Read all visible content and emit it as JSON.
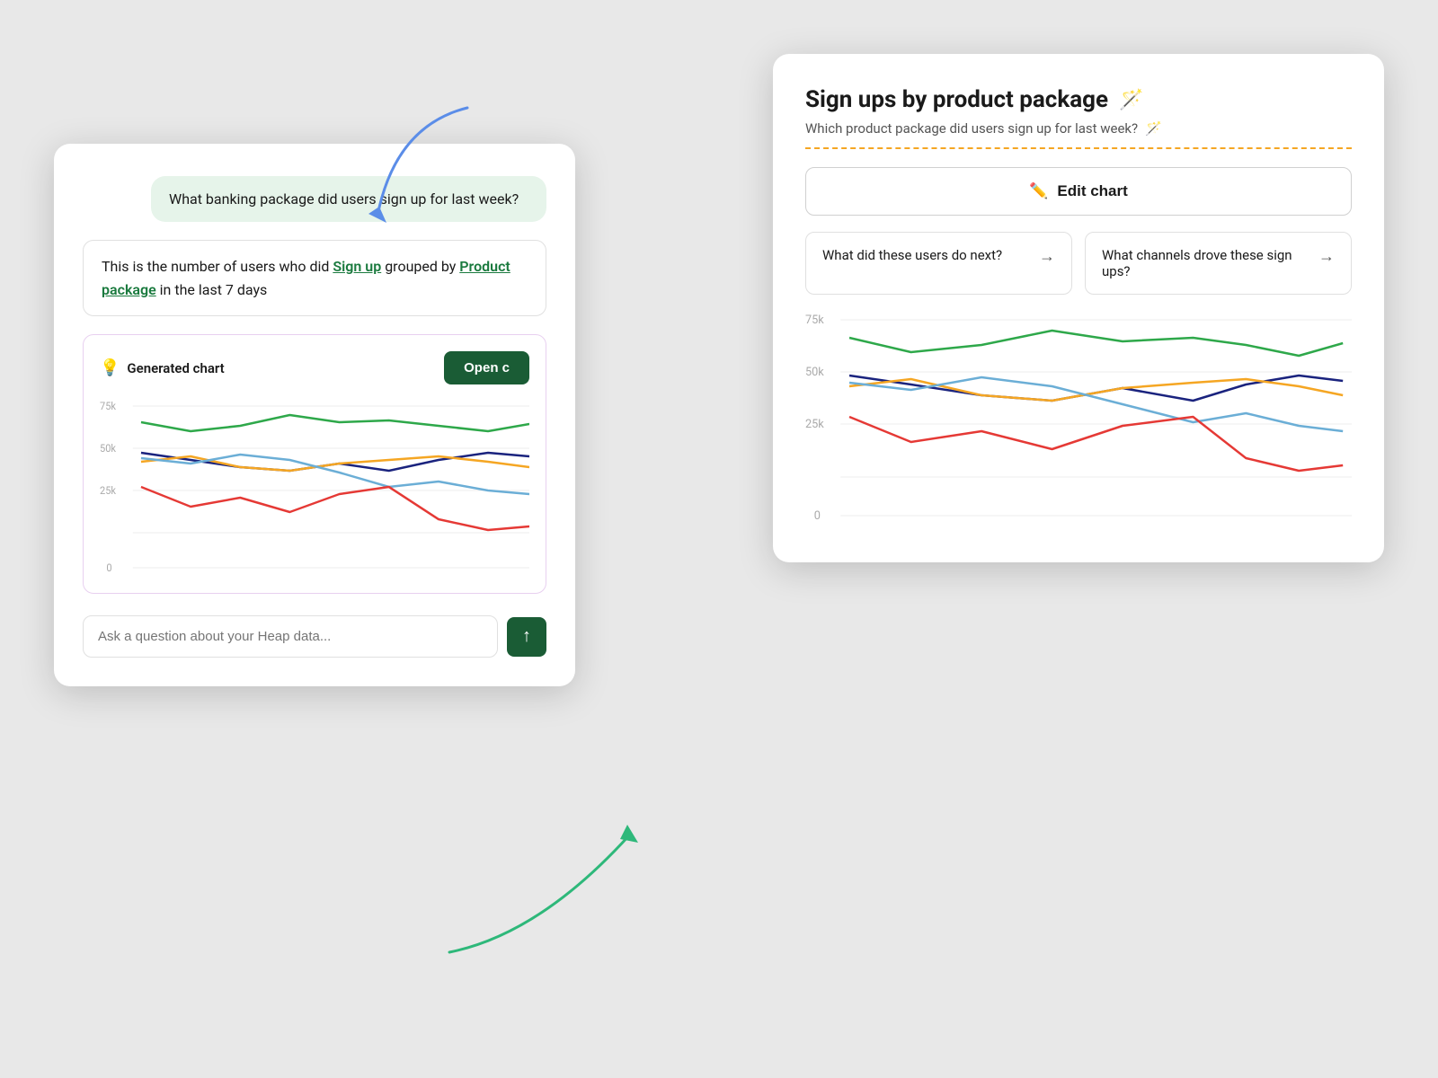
{
  "leftCard": {
    "userMessage": "What banking package did users sign up for last week?",
    "answerText1": "This is the number of users who did ",
    "answerLink1": "Sign up",
    "answerText2": " grouped by ",
    "answerLink2": "Product package",
    "answerText3": " in the last 7 days",
    "generatedChartLabel": "Generated chart",
    "openButtonLabel": "Open c",
    "inputPlaceholder": "Ask a question about your Heap data...",
    "sendButtonLabel": "↑"
  },
  "rightCard": {
    "title": "Sign ups by product package",
    "titleIcon": "🪄",
    "subtitle": "Which product package did users sign up for last week?",
    "subtitleIcon": "🪄",
    "editChartLabel": "Edit chart",
    "editIcon": "✏️",
    "suggestions": [
      {
        "text": "What did these users do next?",
        "arrow": "→"
      },
      {
        "text": "What channels drove these sign ups?",
        "arrow": "→"
      }
    ]
  },
  "chart": {
    "yLabels": [
      "75k",
      "50k",
      "25k",
      "0"
    ],
    "lines": {
      "green": [
        62,
        55,
        58,
        65,
        60,
        62,
        58,
        55,
        60
      ],
      "darkBlue": [
        48,
        44,
        40,
        38,
        42,
        36,
        44,
        48,
        46
      ],
      "orange": [
        44,
        46,
        40,
        38,
        42,
        44,
        46,
        44,
        40
      ],
      "blue": [
        45,
        42,
        48,
        44,
        38,
        32,
        36,
        32,
        30
      ],
      "red": [
        32,
        24,
        28,
        22,
        30,
        34,
        20,
        16,
        18
      ]
    }
  }
}
